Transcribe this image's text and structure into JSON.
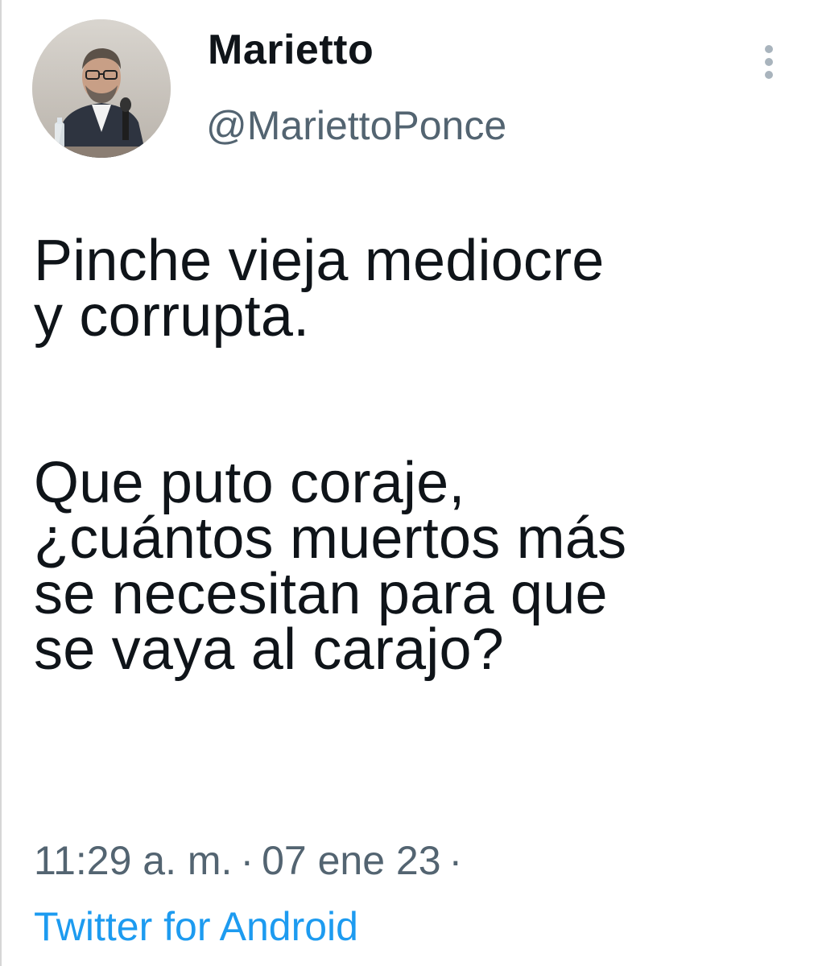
{
  "tweet": {
    "author": {
      "display_name": "Marietto",
      "handle": "@MariettoPonce"
    },
    "text_paragraphs": [
      "Pinche vieja mediocre\ny corrupta.",
      "Que puto coraje,\n¿cuántos muertos más\nse necesitan para que\nse vaya al carajo?"
    ],
    "time": "11:29 a. m.",
    "date": "07 ene 23",
    "separator": "·",
    "source": "Twitter for Android",
    "more_icon": "more-vertical-icon",
    "colors": {
      "text": "#0f1419",
      "secondary": "#536471",
      "link": "#1d9bf0"
    }
  }
}
